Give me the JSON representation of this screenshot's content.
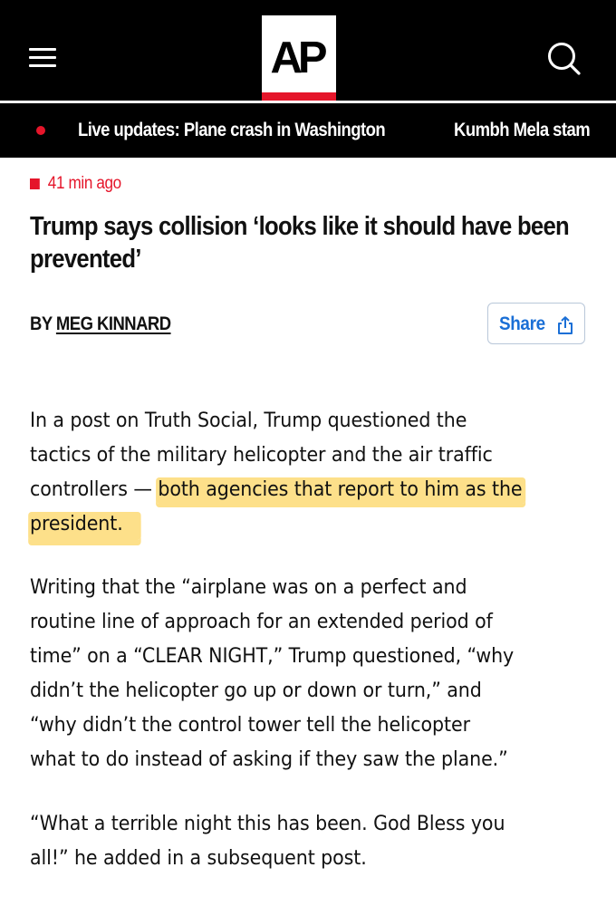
{
  "header": {
    "logo_text": "AP",
    "menu_icon": "hamburger-menu-icon",
    "search_icon": "search-icon",
    "brand_red": "#e5152a"
  },
  "ticker": {
    "items": [
      "Live updates: Plane crash in Washington",
      "Kumbh Mela stam"
    ]
  },
  "article": {
    "timestamp": "41 min ago",
    "headline": "Trump says collision ‘looks like it should have been prevented’",
    "byline_prefix": "BY",
    "author": "MEG KINNARD",
    "share_label": "Share",
    "share_icon": "share-icon",
    "highlight_color": "#fde08a",
    "paragraphs": [
      {
        "lines": [
          "In a post on Truth Social, Trump questioned the",
          "tactics of the military helicopter and the air traffic",
          "controllers — ",
          "both agencies that report to him as the",
          "president."
        ]
      },
      {
        "lines": [
          "Writing that the “airplane was on a perfect and",
          "routine line of approach for an extended period of",
          "time” on a “CLEAR NIGHT,” Trump questioned, “why",
          "didn’t the helicopter go up or down or turn,” and",
          "“why didn’t the control tower tell the helicopter",
          "what to do instead of asking if they saw the plane.”"
        ]
      },
      {
        "lines": [
          "“What a terrible night this has been. God Bless you",
          "all!” he added in a subsequent post."
        ]
      }
    ]
  }
}
